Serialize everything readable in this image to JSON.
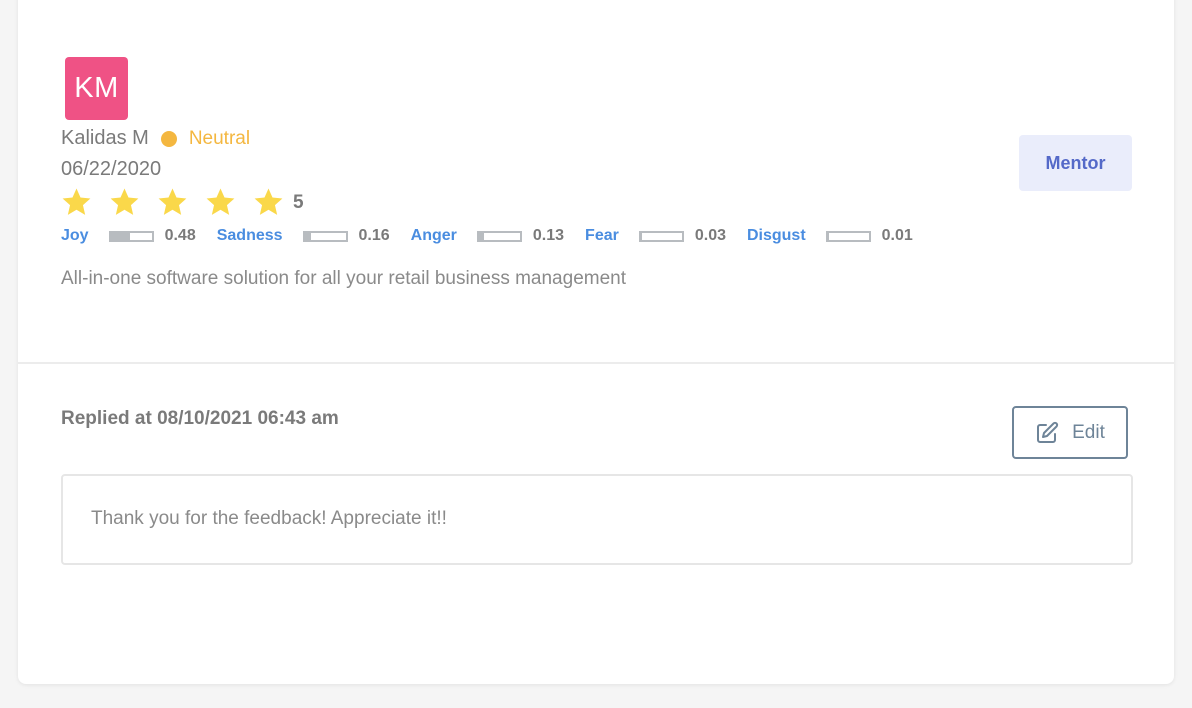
{
  "review": {
    "avatar_initials": "KM",
    "avatar_color": "#ef5285",
    "author_name": "Kalidas M",
    "sentiment_label": "Neutral",
    "sentiment_color": "#f4b740",
    "date": "06/22/2020",
    "rating": 5,
    "rating_label": "5",
    "star_color": "#fad84a",
    "role_label": "Mentor",
    "text": "All-in-one software solution for all your retail business management"
  },
  "emotions": [
    {
      "label": "Joy",
      "value": 0.48,
      "value_label": "0.48"
    },
    {
      "label": "Sadness",
      "value": 0.16,
      "value_label": "0.16"
    },
    {
      "label": "Anger",
      "value": 0.13,
      "value_label": "0.13"
    },
    {
      "label": "Fear",
      "value": 0.03,
      "value_label": "0.03"
    },
    {
      "label": "Disgust",
      "value": 0.01,
      "value_label": "0.01"
    }
  ],
  "reply": {
    "replied_at": "Replied at 08/10/2021 06:43 am",
    "edit_label": "Edit",
    "edit_icon": "edit-icon",
    "text": "Thank you for the feedback! Appreciate it!!"
  }
}
